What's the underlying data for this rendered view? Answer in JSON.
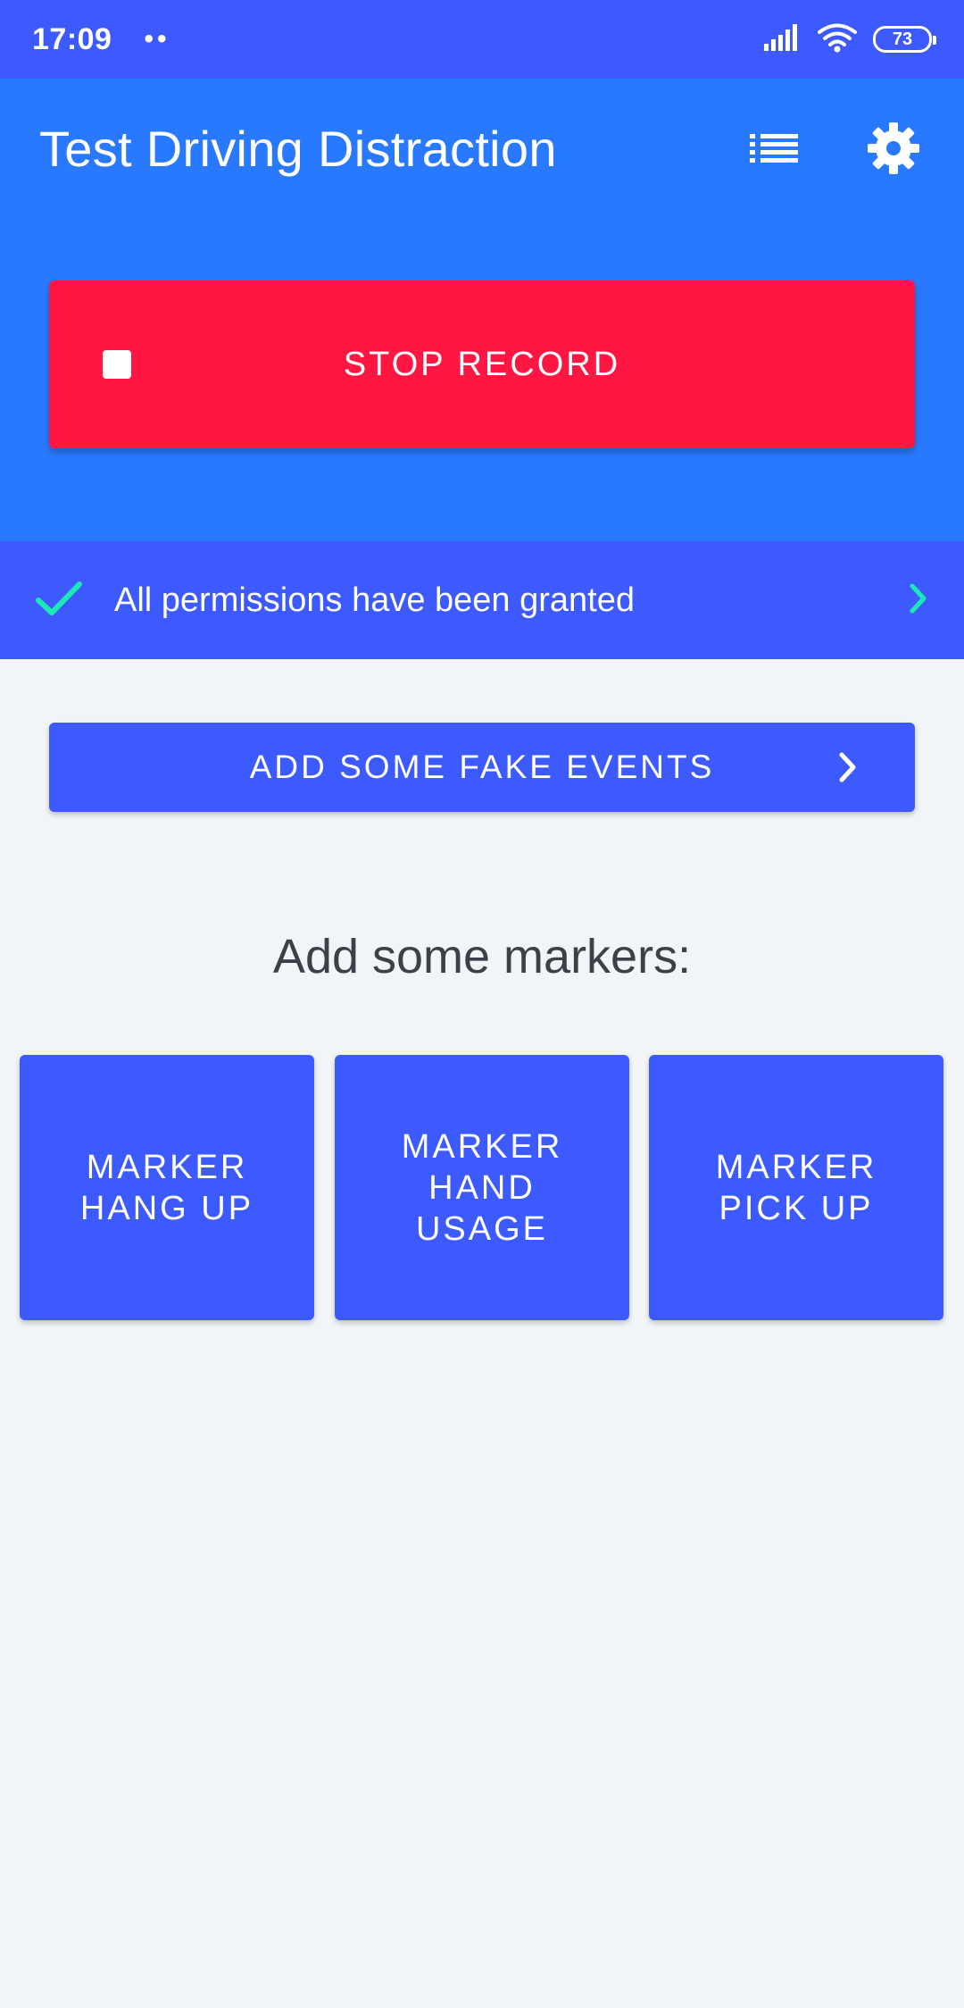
{
  "status_bar": {
    "time": "17:09",
    "dots": "••",
    "battery": "73",
    "icons": [
      "signal-icon",
      "wifi-icon",
      "battery-icon"
    ]
  },
  "app_bar": {
    "title": "Test Driving Distraction",
    "icons": [
      "list-icon",
      "settings-gear-icon"
    ]
  },
  "record": {
    "stop_label": "STOP RECORD",
    "icon": "stop-square-icon"
  },
  "permissions": {
    "text": "All permissions have been granted",
    "icons": [
      "check-icon",
      "chevron-right-icon"
    ]
  },
  "fake_events": {
    "label": "ADD SOME FAKE EVENTS",
    "icon": "chevron-right-icon"
  },
  "markers": {
    "title": "Add some markers:",
    "buttons": [
      {
        "label": "MARKER\nHANG UP"
      },
      {
        "label": "MARKER\nHAND\nUSAGE"
      },
      {
        "label": "MARKER\nPICK UP"
      }
    ]
  },
  "colors": {
    "status_bar": "#3d5afe",
    "primary": "#2979ff",
    "accent_indigo": "#3d5afe",
    "stop_red": "#ff1744",
    "check_green": "#1de9b6",
    "background": "#f2f5f8"
  }
}
